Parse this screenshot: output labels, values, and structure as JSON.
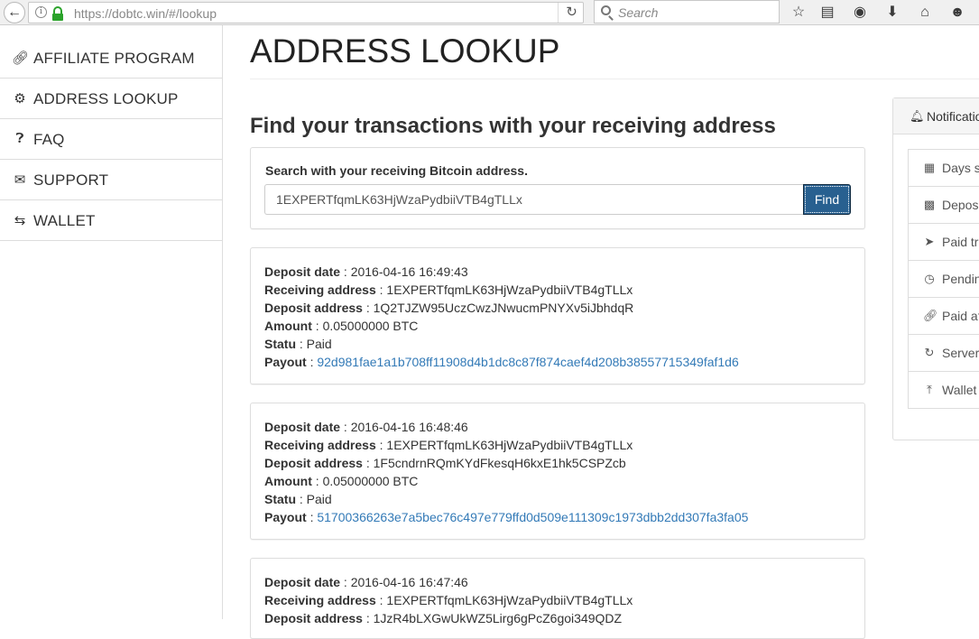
{
  "browser": {
    "url": "https://dobtc.win/#/lookup",
    "search_placeholder": "Search"
  },
  "sidebar": {
    "items": [
      {
        "label": "AFFILIATE PROGRAM",
        "icon": "link-icon"
      },
      {
        "label": "ADDRESS LOOKUP",
        "icon": "gears-icon"
      },
      {
        "label": "FAQ",
        "icon": "question-circle-icon"
      },
      {
        "label": "SUPPORT",
        "icon": "envelope-icon"
      },
      {
        "label": "WALLET",
        "icon": "exchange-icon"
      }
    ]
  },
  "main": {
    "title": "ADDRESS LOOKUP",
    "subtitle": "Find your transactions with your receiving address",
    "search": {
      "label": "Search with your receiving Bitcoin address.",
      "value": "1EXPERTfqmLK63HjWzaPydbiiVTB4gTLLx",
      "button": "Find"
    },
    "field_labels": {
      "deposit_date": "Deposit date",
      "receiving_address": "Receiving address",
      "deposit_address": "Deposit address",
      "amount": "Amount",
      "status": "Statu",
      "payout": "Payout"
    },
    "separator": " : ",
    "transactions": [
      {
        "deposit_date": "2016-04-16 16:49:43",
        "receiving_address": "1EXPERTfqmLK63HjWzaPydbiiVTB4gTLLx",
        "deposit_address": "1Q2TJZW95UczCwzJNwucmPNYXv5iJbhdqR",
        "amount": "0.05000000 BTC",
        "status": "Paid",
        "payout": "92d981fae1a1b708ff11908d4b1dc8c87f874caef4d208b38557715349faf1d6"
      },
      {
        "deposit_date": "2016-04-16 16:48:46",
        "receiving_address": "1EXPERTfqmLK63HjWzaPydbiiVTB4gTLLx",
        "deposit_address": "1F5cndrnRQmKYdFkesqH6kxE1hk5CSPZcb",
        "amount": "0.05000000 BTC",
        "status": "Paid",
        "payout": "51700366263e7a5bec76c497e779ffd0d509e111309c1973dbb2dd307fa3fa05"
      },
      {
        "deposit_date": "2016-04-16 16:47:46",
        "receiving_address": "1EXPERTfqmLK63HjWzaPydbiiVTB4gTLLx",
        "deposit_address": "1JzR4bLXGwUkWZ5Lirg6gPcZ6goi349QDZ"
      }
    ]
  },
  "notifications": {
    "title": "Notificatio",
    "items": [
      {
        "label": "Days s",
        "icon": "calendar-icon"
      },
      {
        "label": "Depos",
        "icon": "qrcode-icon"
      },
      {
        "label": "Paid tr",
        "icon": "paper-plane-icon"
      },
      {
        "label": "Pendin",
        "icon": "clock-icon"
      },
      {
        "label": "Paid af",
        "icon": "link-icon"
      },
      {
        "label": "Server",
        "icon": "refresh-icon"
      },
      {
        "label": "Wallet",
        "icon": "upload-icon"
      }
    ]
  }
}
